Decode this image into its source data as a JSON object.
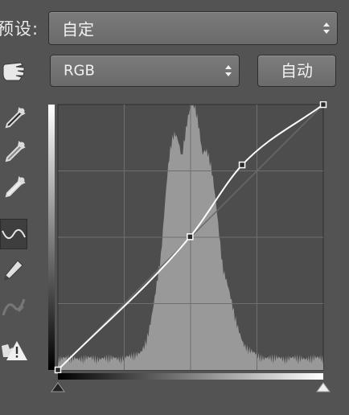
{
  "preset": {
    "label": "预设:",
    "value": "自定"
  },
  "channel": {
    "value": "RGB"
  },
  "auto_button": {
    "label": "自动"
  },
  "tools": [
    {
      "name": "hand-adjust-icon"
    },
    {
      "name": "black-point-eyedropper-icon"
    },
    {
      "name": "gray-point-eyedropper-icon"
    },
    {
      "name": "white-point-eyedropper-icon"
    },
    {
      "name": "curve-point-edit-icon",
      "selected": true
    },
    {
      "name": "pencil-draw-icon"
    },
    {
      "name": "smooth-curve-icon",
      "disabled": true
    },
    {
      "name": "clipping-warning-icon"
    }
  ],
  "curve": {
    "input_range": [
      0,
      255
    ],
    "output_range": [
      0,
      255
    ],
    "points": [
      [
        0,
        0
      ],
      [
        127,
        128
      ],
      [
        177,
        197
      ],
      [
        255,
        255
      ]
    ],
    "grid_divisions": 4,
    "histogram_shown": true
  },
  "colors": {
    "panel_bg": "#535353",
    "graph_bg": "#4d4d4d",
    "histogram": "#999999",
    "curve": "#ffffff"
  }
}
